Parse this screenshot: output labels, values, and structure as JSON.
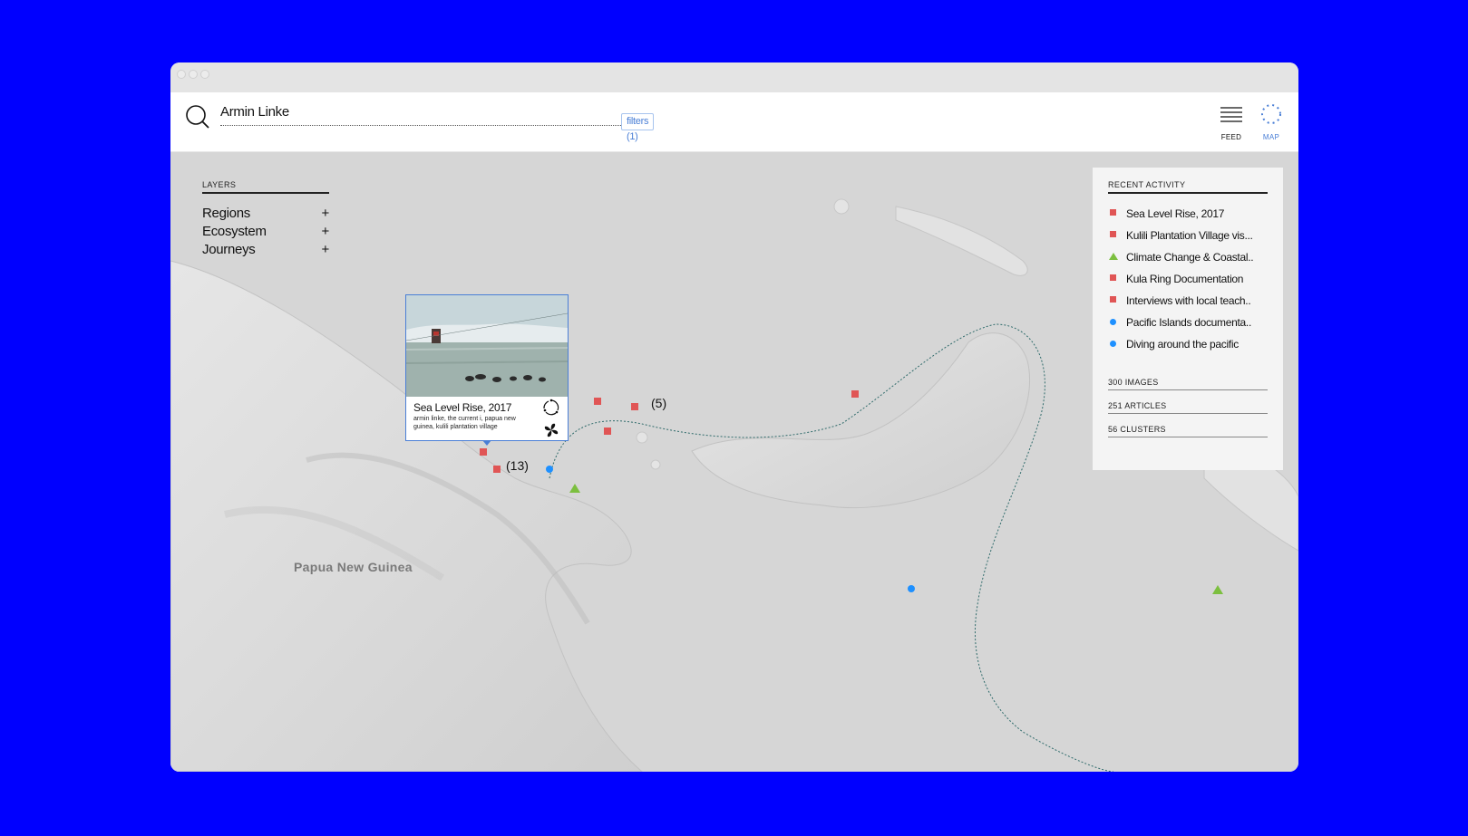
{
  "search": {
    "query": "Armin Linke",
    "filters_label": "filters (1)"
  },
  "nav": {
    "feed_label": "FEED",
    "map_label": "MAP"
  },
  "layers": {
    "title": "LAYERS",
    "items": [
      {
        "label": "Regions",
        "toggle": "+"
      },
      {
        "label": "Ecosystem",
        "toggle": "+"
      },
      {
        "label": "Journeys",
        "toggle": "+"
      }
    ]
  },
  "recent": {
    "title": "RECENT ACTIVITY",
    "items": [
      {
        "label": "Sea Level Rise, 2017",
        "marker": "square"
      },
      {
        "label": "Kulili Plantation Village vis...",
        "marker": "square"
      },
      {
        "label": "Climate Change & Coastal..",
        "marker": "triangle"
      },
      {
        "label": "Kula Ring Documentation",
        "marker": "square"
      },
      {
        "label": "Interviews with local teach..",
        "marker": "square"
      },
      {
        "label": "Pacific Islands documenta..",
        "marker": "circle"
      },
      {
        "label": "Diving around the pacific",
        "marker": "circle"
      }
    ],
    "stats": [
      {
        "label": "300 IMAGES"
      },
      {
        "label": "251 ARTICLES"
      },
      {
        "label": "56 CLUSTERS"
      }
    ]
  },
  "popup": {
    "title": "Sea Level Rise, 2017",
    "subtitle": "armin linke, the current i, papua new guinea, kulili plantation village",
    "icons": [
      "cycle-icon",
      "fan-icon"
    ]
  },
  "map": {
    "region_label": "Papua New Guinea",
    "cluster_counts": [
      "(5)",
      "(13)"
    ]
  },
  "colors": {
    "background": "#0000ff",
    "accent_blue": "#4a7fd6",
    "marker_red": "#e05555",
    "marker_blue": "#1e90ff",
    "marker_green": "#7cbf3f"
  }
}
